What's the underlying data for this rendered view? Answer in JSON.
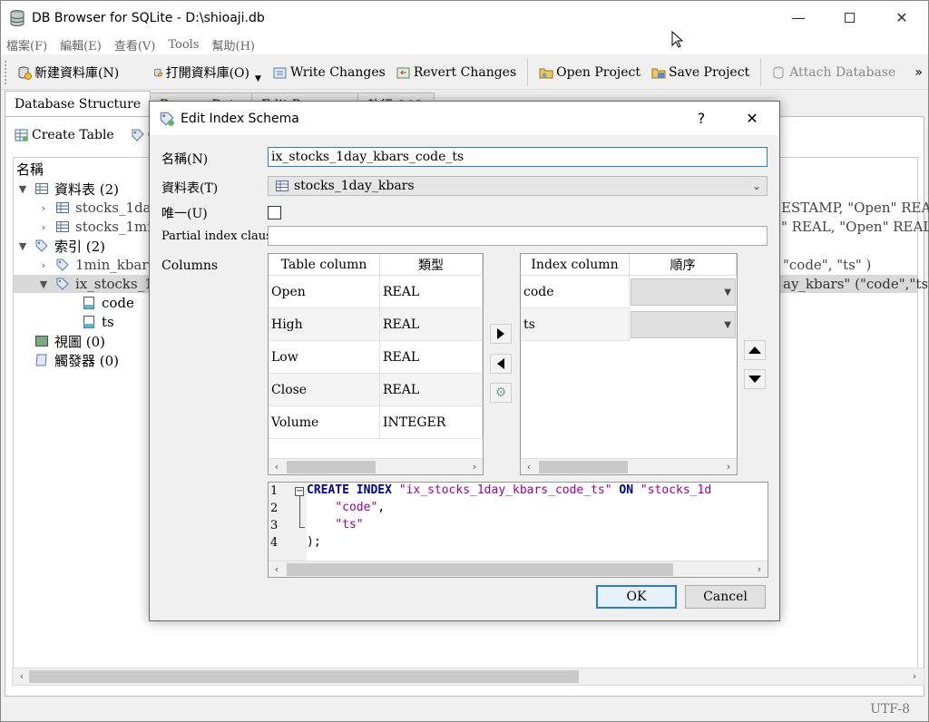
{
  "app": {
    "title": "DB Browser for SQLite - D:\\shioaji.db"
  },
  "menu": [
    "檔案(F)",
    "編輯(E)",
    "查看(V)",
    "Tools",
    "幫助(H)"
  ],
  "toolbar": {
    "new_db": "新建資料庫(N)",
    "open_db": "打開資料庫(O)",
    "write": "Write Changes",
    "revert": "Revert Changes",
    "open_project": "Open Project",
    "save_project": "Save Project",
    "attach": "Attach Database",
    "more": "»"
  },
  "tabs": [
    "Database Structure",
    "Browse Data",
    "Edit Pragmas",
    "執行 SQL"
  ],
  "structure": {
    "create_table": "Create Table",
    "create_index_partial": "Cr",
    "header": "名稱",
    "tables_group": "資料表 (2)",
    "table1": "stocks_1day",
    "table2": "stocks_1min",
    "indexes_group": "索引 (2)",
    "index1": "1min_kbars",
    "index2": "ix_stocks_1d",
    "col_code": "code",
    "col_ts": "ts",
    "views_group": "視圖 (0)",
    "triggers_group": "觸發器 (0)",
    "schema1": "ESTAMP, \"Open\" REAL",
    "schema2": "\" REAL, \"Open\" REAL",
    "schema3": "\"code\", \"ts\" )",
    "schema4": "ay_kbars\" (\"code\",\"ts\")"
  },
  "status": {
    "encoding": "UTF-8"
  },
  "dialog": {
    "title": "Edit Index Schema",
    "help": "?",
    "close": "✕",
    "name_label": "名稱(N)",
    "name_value": "ix_stocks_1day_kbars_code_ts",
    "table_label": "資料表(T)",
    "table_value": "stocks_1day_kbars",
    "unique_label": "唯一(U)",
    "partial_label": "Partial index clause",
    "partial_value": "",
    "columns_label": "Columns",
    "table_columns": {
      "headers": [
        "Table column",
        "類型"
      ],
      "rows": [
        [
          "Open",
          "REAL"
        ],
        [
          "High",
          "REAL"
        ],
        [
          "Low",
          "REAL"
        ],
        [
          "Close",
          "REAL"
        ],
        [
          "Volume",
          "INTEGER"
        ]
      ]
    },
    "index_columns": {
      "headers": [
        "Index column",
        "順序"
      ],
      "rows": [
        {
          "column": "code",
          "order": ""
        },
        {
          "column": "ts",
          "order": ""
        }
      ]
    },
    "sql_line_numbers": [
      "1",
      "2",
      "3",
      "4"
    ],
    "sql": {
      "kw1": "CREATE",
      "kw2": "INDEX",
      "idx_name": "\"ix_stocks_1day_kbars_code_ts\"",
      "kw3": "ON",
      "tbl": "\"stocks_1d",
      "code": "\"code\"",
      "comma": ",",
      "ts": "\"ts\"",
      "end": ");"
    },
    "ok": "OK",
    "cancel": "Cancel"
  }
}
